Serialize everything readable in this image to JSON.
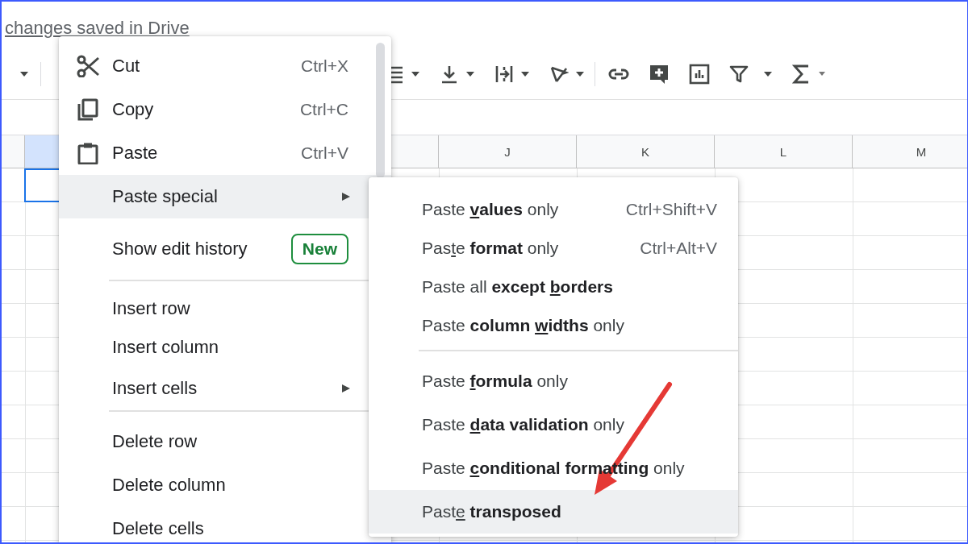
{
  "header": {
    "save_status": "changes saved in Drive"
  },
  "sheet": {
    "selection": {
      "selected": true
    },
    "columns": [
      {
        "label": "J"
      },
      {
        "label": "K"
      },
      {
        "label": "L"
      },
      {
        "label": "M"
      }
    ]
  },
  "context_menu": {
    "items": [
      {
        "kind": "command",
        "label": "Cut",
        "shortcut": "Ctrl+X",
        "has_icon": true,
        "selected": false
      },
      {
        "kind": "command",
        "label": "Copy",
        "shortcut": "Ctrl+C",
        "has_icon": true,
        "selected": false
      },
      {
        "kind": "command",
        "label": "Paste",
        "shortcut": "Ctrl+V",
        "has_icon": true,
        "selected": false
      },
      {
        "kind": "submenu",
        "label": "Paste special",
        "selected": true
      },
      {
        "kind": "badged",
        "label": "Show edit history",
        "badge": "New",
        "selected": false
      },
      {
        "kind": "separator"
      },
      {
        "kind": "compact",
        "label": "Insert row",
        "selected": false
      },
      {
        "kind": "compact",
        "label": "Insert column",
        "selected": false
      },
      {
        "kind": "submenu",
        "label": "Insert cells",
        "selected": false
      },
      {
        "kind": "separator"
      },
      {
        "kind": "command",
        "label": "Delete row",
        "selected": false
      },
      {
        "kind": "command",
        "label": "Delete column",
        "selected": false
      },
      {
        "kind": "command",
        "label": "Delete cells",
        "selected": false
      }
    ]
  },
  "paste_special_menu": {
    "items": [
      {
        "kind": "compact",
        "parts": [
          {
            "text": "Paste "
          },
          {
            "text": "v",
            "bold": true,
            "underline": true
          },
          {
            "text": "alues",
            "bold": true
          },
          {
            "text": " only"
          }
        ],
        "shortcut": "Ctrl+Shift+V",
        "selected": false
      },
      {
        "kind": "compact",
        "parts": [
          {
            "text": "Pas"
          },
          {
            "text": "t",
            "underline": true
          },
          {
            "text": "e "
          },
          {
            "text": "format",
            "bold": true
          },
          {
            "text": " only"
          }
        ],
        "shortcut": "Ctrl+Alt+V",
        "selected": false
      },
      {
        "kind": "compact",
        "parts": [
          {
            "text": "Paste all "
          },
          {
            "text": "except ",
            "bold": true
          },
          {
            "text": "b",
            "bold": true,
            "underline": true
          },
          {
            "text": "orders",
            "bold": true
          }
        ],
        "selected": false
      },
      {
        "kind": "compact",
        "parts": [
          {
            "text": "Paste "
          },
          {
            "text": "column ",
            "bold": true
          },
          {
            "text": "w",
            "bold": true,
            "underline": true
          },
          {
            "text": "idths",
            "bold": true
          },
          {
            "text": " only"
          }
        ],
        "selected": false
      },
      {
        "kind": "separator"
      },
      {
        "kind": "command",
        "parts": [
          {
            "text": "Paste "
          },
          {
            "text": "f",
            "bold": true,
            "underline": true
          },
          {
            "text": "ormula",
            "bold": true
          },
          {
            "text": " only"
          }
        ],
        "selected": false
      },
      {
        "kind": "command",
        "parts": [
          {
            "text": "Paste "
          },
          {
            "text": "d",
            "bold": true,
            "underline": true
          },
          {
            "text": "ata validation",
            "bold": true
          },
          {
            "text": " only"
          }
        ],
        "selected": false
      },
      {
        "kind": "command",
        "parts": [
          {
            "text": "Paste "
          },
          {
            "text": "c",
            "bold": true,
            "underline": true
          },
          {
            "text": "onditional formatting",
            "bold": true
          },
          {
            "text": " only"
          }
        ],
        "selected": false
      },
      {
        "kind": "command",
        "parts": [
          {
            "text": "Past"
          },
          {
            "text": "e",
            "underline": true
          },
          {
            "text": " transposed",
            "bold": true
          }
        ],
        "selected": true
      }
    ]
  },
  "overlay": {
    "kind": "arrow"
  }
}
